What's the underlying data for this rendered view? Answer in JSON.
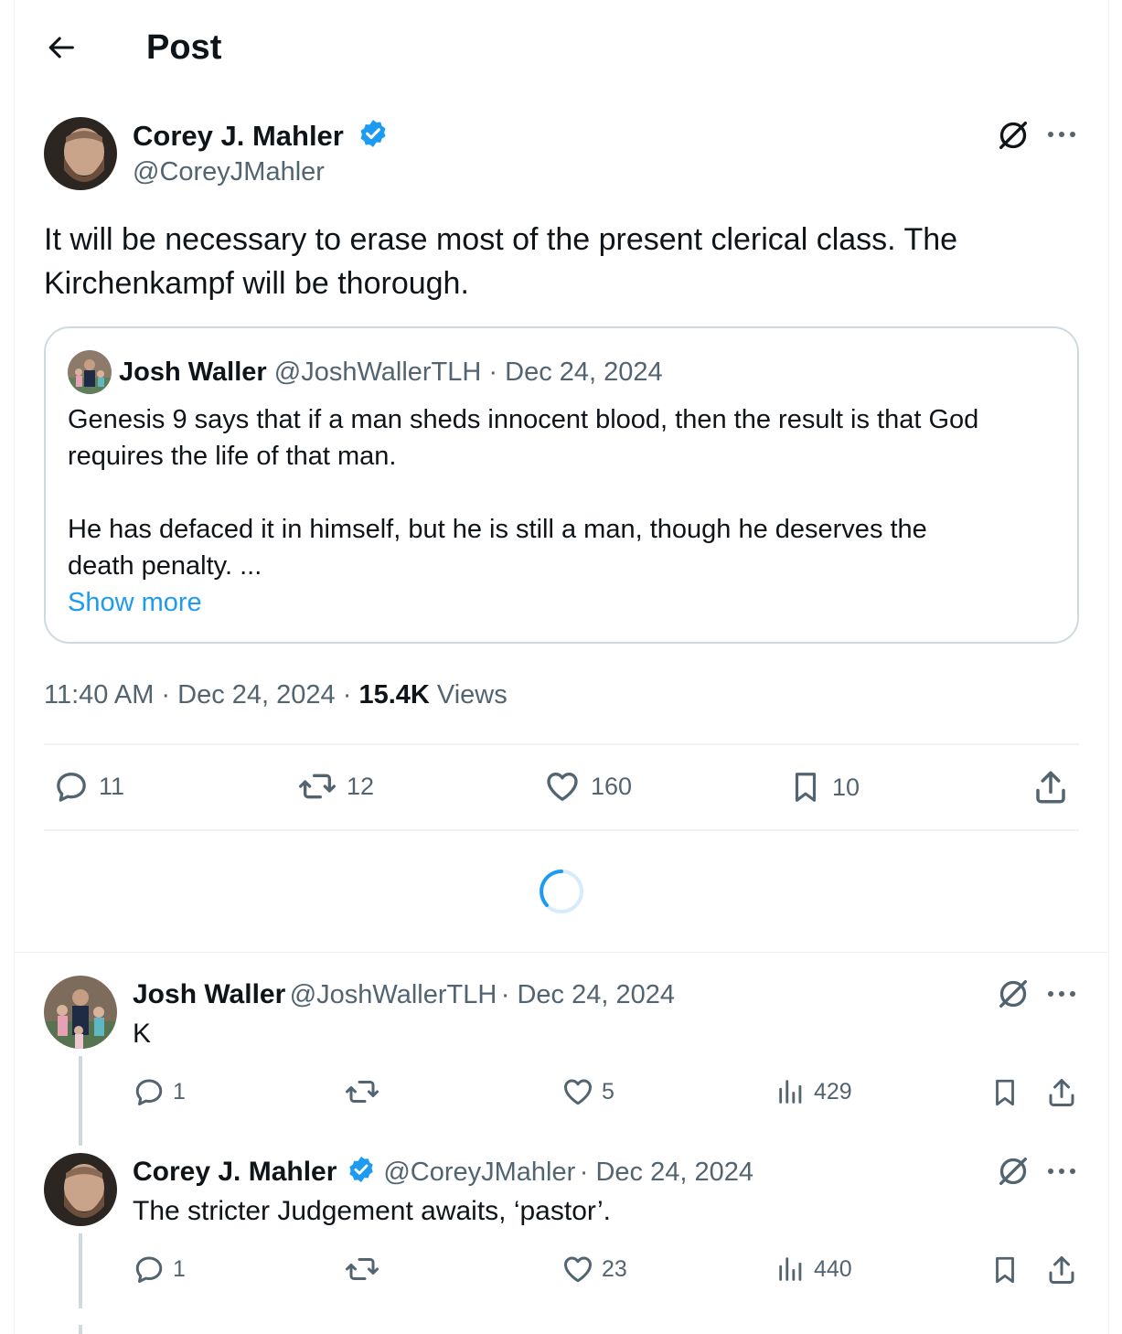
{
  "header": {
    "title": "Post"
  },
  "post": {
    "author_name": "Corey J. Mahler",
    "author_handle": "@CoreyJMahler",
    "text_line1": "It will be necessary to erase most of the present clerical class. The",
    "text_line2": "Kirchenkampf will be thorough.",
    "quote": {
      "author_name": "Josh Waller",
      "author_handle": "@JoshWallerTLH",
      "date": "· Dec 24, 2024",
      "line1": "Genesis 9 says that if a man sheds innocent blood, then the result is that God",
      "line2": "requires the life of that man.",
      "line3": "He has defaced it in himself, but he is still a man, though he deserves the",
      "line4": "death penalty. ...",
      "show_more": "Show more"
    },
    "timestamp": "11:40 AM · Dec 24, 2024 · ",
    "views_count": "15.4K",
    "views_label": " Views",
    "stats": {
      "replies": "11",
      "reposts": "12",
      "likes": "160",
      "bookmarks": "10"
    }
  },
  "replies": [
    {
      "author_name": "Josh Waller",
      "author_handle": "@JoshWallerTLH",
      "date": "· Dec 24, 2024",
      "text": "K",
      "stats": {
        "replies": "1",
        "reposts": "",
        "likes": "5",
        "views": "429"
      }
    },
    {
      "author_name": "Corey J. Mahler",
      "author_handle": "@CoreyJMahler",
      "date": "· Dec 24, 2024",
      "text": "The stricter Judgement awaits, ‘pastor’.",
      "stats": {
        "replies": "1",
        "reposts": "",
        "likes": "23",
        "views": "440"
      }
    }
  ],
  "icons": {
    "back": "arrow-left-icon",
    "grok": "grok-icon",
    "more": "more-dots-icon",
    "verified": "verified-badge-icon",
    "reply": "reply-icon",
    "repost": "repost-icon",
    "like": "heart-icon",
    "bookmark": "bookmark-icon",
    "share": "share-icon",
    "views": "views-icon"
  },
  "colors": {
    "accent": "#1d9bf0",
    "secondary_text": "#536471",
    "border": "#cfd9de"
  }
}
